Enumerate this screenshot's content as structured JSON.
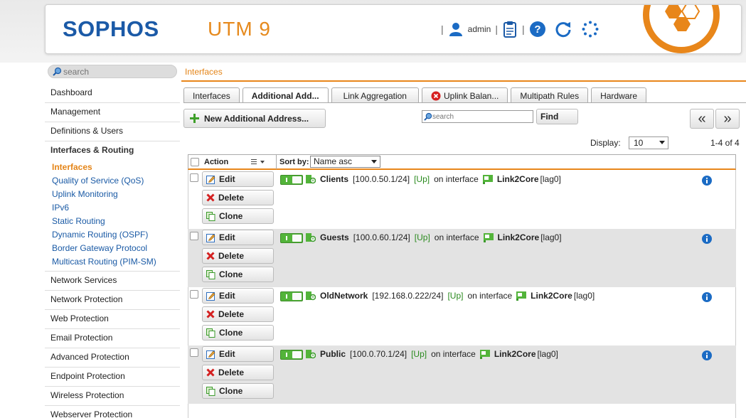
{
  "header": {
    "brand": "SOPHOS",
    "product": "UTM 9",
    "user": "admin",
    "separator": "|"
  },
  "sidebar": {
    "search_placeholder": "search",
    "items": [
      {
        "label": "Dashboard"
      },
      {
        "label": "Management"
      },
      {
        "label": "Definitions & Users"
      },
      {
        "label": "Interfaces & Routing"
      },
      {
        "label": "Network Services"
      },
      {
        "label": "Network Protection"
      },
      {
        "label": "Web Protection"
      },
      {
        "label": "Email Protection"
      },
      {
        "label": "Advanced Protection"
      },
      {
        "label": "Endpoint Protection"
      },
      {
        "label": "Wireless Protection"
      },
      {
        "label": "Webserver Protection"
      }
    ],
    "subitems": [
      {
        "label": "Interfaces"
      },
      {
        "label": "Quality of Service (QoS)"
      },
      {
        "label": "Uplink Monitoring"
      },
      {
        "label": "IPv6"
      },
      {
        "label": "Static Routing"
      },
      {
        "label": "Dynamic Routing (OSPF)"
      },
      {
        "label": "Border Gateway Protocol"
      },
      {
        "label": "Multicast Routing (PIM-SM)"
      }
    ]
  },
  "breadcrumb": "Interfaces",
  "tabs": [
    {
      "label": "Interfaces"
    },
    {
      "label": "Additional Add..."
    },
    {
      "label": "Link Aggregation"
    },
    {
      "label": "Uplink Balan..."
    },
    {
      "label": "Multipath Rules"
    },
    {
      "label": "Hardware"
    }
  ],
  "toolbar": {
    "new_label": "New Additional Address...",
    "search_placeholder": "search",
    "find_label": "Find",
    "prev_label": "«",
    "next_label": "»",
    "display_label": "Display:",
    "display_value": "10",
    "count": "1-4 of 4"
  },
  "table": {
    "action_header": "Action",
    "sort_label": "Sort by:",
    "sort_value": "Name asc",
    "edit_label": "Edit",
    "delete_label": "Delete",
    "clone_label": "Clone",
    "on_interface": "on interface",
    "rows": [
      {
        "name": "Clients",
        "address": "[100.0.50.1/24]",
        "status": "[Up]",
        "interface": "Link2Core",
        "iface_tag": "[lag0]"
      },
      {
        "name": "Guests",
        "address": "[100.0.60.1/24]",
        "status": "[Up]",
        "interface": "Link2Core",
        "iface_tag": "[lag0]"
      },
      {
        "name": "OldNetwork",
        "address": "[192.168.0.222/24]",
        "status": "[Up]",
        "interface": "Link2Core",
        "iface_tag": "[lag0]"
      },
      {
        "name": "Public",
        "address": "[100.0.70.1/24]",
        "status": "[Up]",
        "interface": "Link2Core",
        "iface_tag": "[lag0]"
      }
    ]
  },
  "colors": {
    "accent": "#e8861a",
    "brand": "#1b5aa7",
    "link": "#1a5aa5",
    "toggle_on": "#53b43a"
  },
  "icons": [
    "user-icon",
    "clipboard-icon",
    "help-icon",
    "refresh-icon",
    "spinner-icon",
    "search-icon",
    "plus-icon",
    "error-icon",
    "edit-icon",
    "delete-icon",
    "clone-icon",
    "network-icon",
    "interface-icon",
    "info-icon"
  ]
}
